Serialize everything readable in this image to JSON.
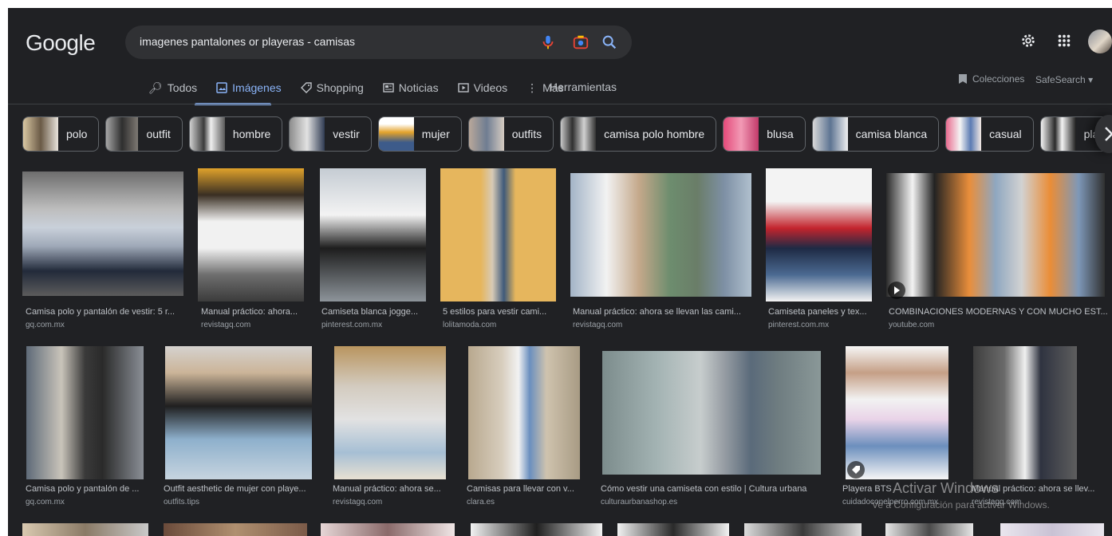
{
  "header": {
    "logo": "Google",
    "search_query": "imagenes pantalones or playeras - camisas"
  },
  "nav": {
    "tabs": [
      {
        "label": "Todos",
        "icon": "search-icon",
        "active": false
      },
      {
        "label": "Imágenes",
        "icon": "image-icon",
        "active": true
      },
      {
        "label": "Shopping",
        "icon": "tag-icon",
        "active": false
      },
      {
        "label": "Noticias",
        "icon": "news-icon",
        "active": false
      },
      {
        "label": "Videos",
        "icon": "play-icon",
        "active": false
      },
      {
        "label": "Más",
        "icon": "more-vert-icon",
        "active": false
      }
    ],
    "tools": "Herramientas",
    "collections": "Colecciones",
    "safesearch": "SafeSearch"
  },
  "chips": [
    {
      "label": "polo"
    },
    {
      "label": "outfit"
    },
    {
      "label": "hombre"
    },
    {
      "label": "vestir"
    },
    {
      "label": "mujer"
    },
    {
      "label": "outfits"
    },
    {
      "label": "camisa polo hombre"
    },
    {
      "label": "blusa"
    },
    {
      "label": "camisa blanca"
    },
    {
      "label": "casual"
    },
    {
      "label": "pla"
    }
  ],
  "row1": [
    {
      "caption": "Camisa polo y pantalón de vestir: 5 r...",
      "source": "gq.com.mx"
    },
    {
      "caption": "Manual práctico: ahora...",
      "source": "revistagq.com"
    },
    {
      "caption": "Camiseta blanca jogge...",
      "source": "pinterest.com.mx"
    },
    {
      "caption": "5 estilos para vestir cami...",
      "source": "lolitamoda.com"
    },
    {
      "caption": "Manual práctico: ahora se llevan las cami...",
      "source": "revistagq.com"
    },
    {
      "caption": "Camiseta paneles y tex...",
      "source": "pinterest.com.mx"
    },
    {
      "caption": "COMBINACIONES MODERNAS Y CON MUCHO EST...",
      "source": "youtube.com"
    }
  ],
  "row2": [
    {
      "caption": "Camisa polo y pantalón de ...",
      "source": "gq.com.mx"
    },
    {
      "caption": "Outfit aesthetic de mujer con playe...",
      "source": "outfits.tips"
    },
    {
      "caption": "Manual práctico: ahora se...",
      "source": "revistagq.com"
    },
    {
      "caption": "Camisas para llevar con v...",
      "source": "clara.es"
    },
    {
      "caption": "Cómo vestir una camiseta con estilo | Cultura urbana",
      "source": "culturaurbanashop.es"
    },
    {
      "caption": "Playera BTS ...",
      "source": "cuidadoconelperro.com.mx"
    },
    {
      "caption": "Manual práctico: ahora se llev...",
      "source": "revistagq.com"
    }
  ],
  "watermark": {
    "line1": "Activar Windows",
    "line2": "Ve a Configuración para activar Windows."
  },
  "colors": {
    "background": "#202124",
    "accent": "#8ab4f8",
    "searchbox": "#303134",
    "text": "#bdc1c6"
  }
}
